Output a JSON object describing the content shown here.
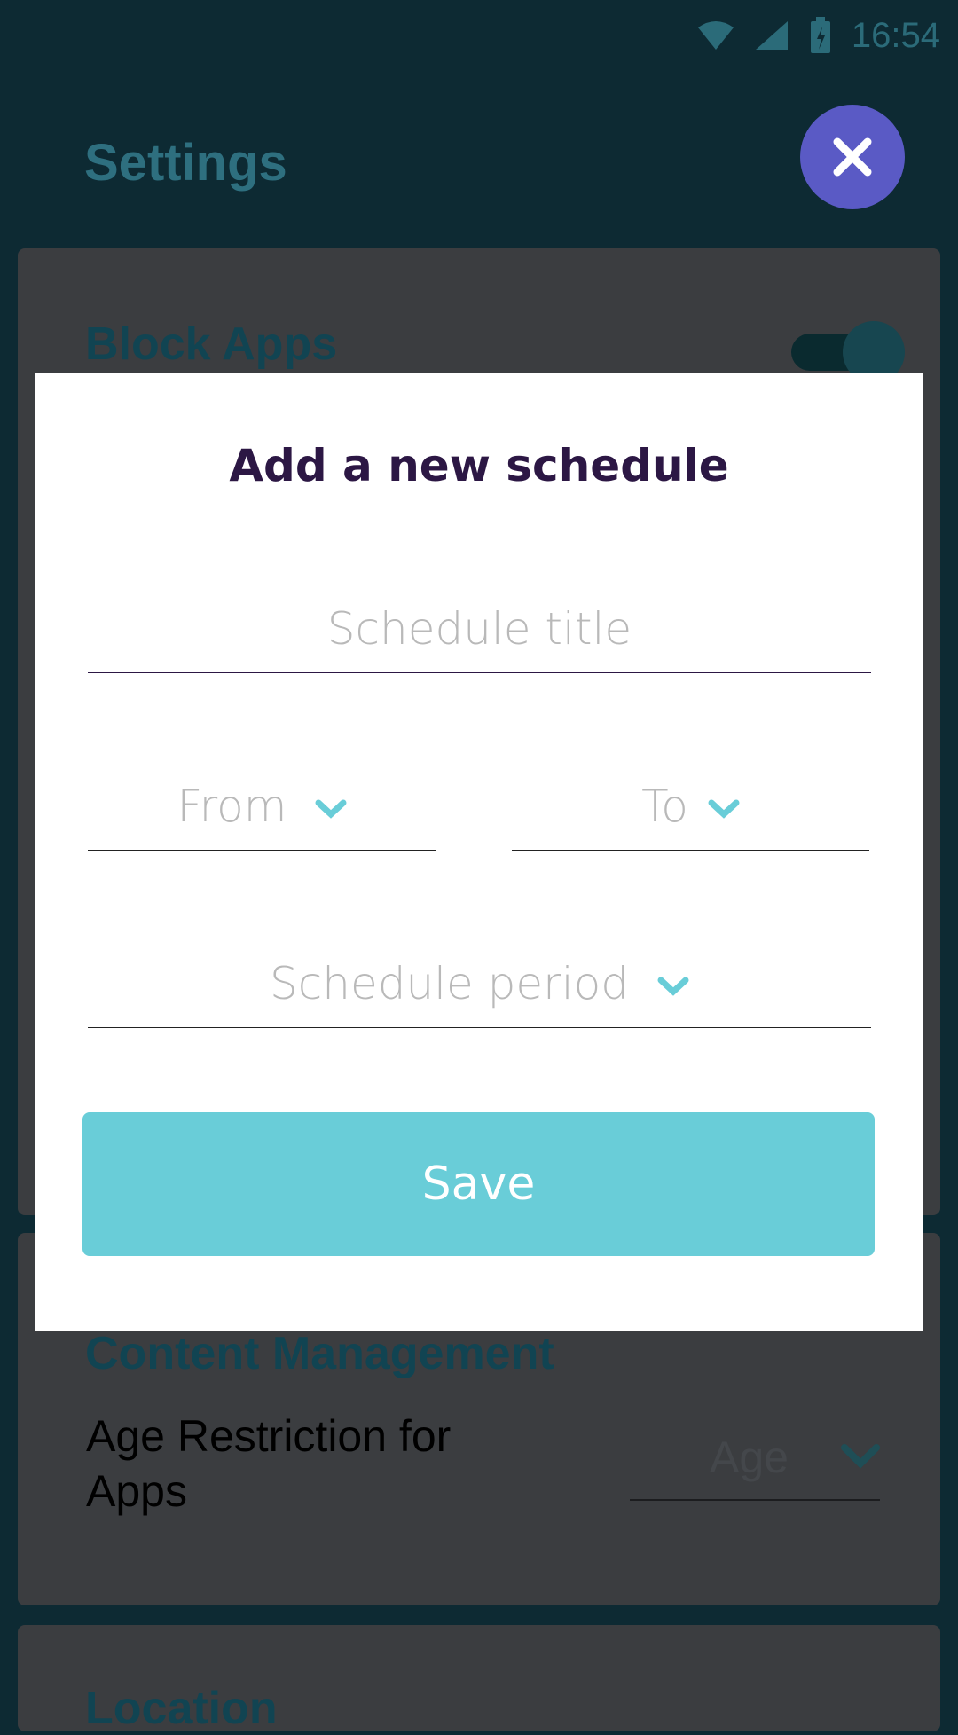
{
  "status_bar": {
    "time": "16:54"
  },
  "app": {
    "title": "Settings"
  },
  "block_apps": {
    "heading": "Block Apps"
  },
  "content_management": {
    "heading": "Content Management",
    "age_label": "Age Restriction for Apps",
    "age_placeholder": "Age"
  },
  "location": {
    "heading": "Location"
  },
  "dialog": {
    "title": "Add a new schedule",
    "schedule_title_placeholder": "Schedule title",
    "from_label": "From",
    "to_label": "To",
    "period_label": "Schedule period",
    "save_label": "Save"
  },
  "colors": {
    "accent": "#69cdd8",
    "fab": "#5a5ac5",
    "dialog_title": "#2c1744",
    "placeholder": "#b9b9b9"
  },
  "icons": [
    "wifi-icon",
    "signal-icon",
    "battery-icon",
    "close-icon",
    "chevron-down-icon"
  ]
}
